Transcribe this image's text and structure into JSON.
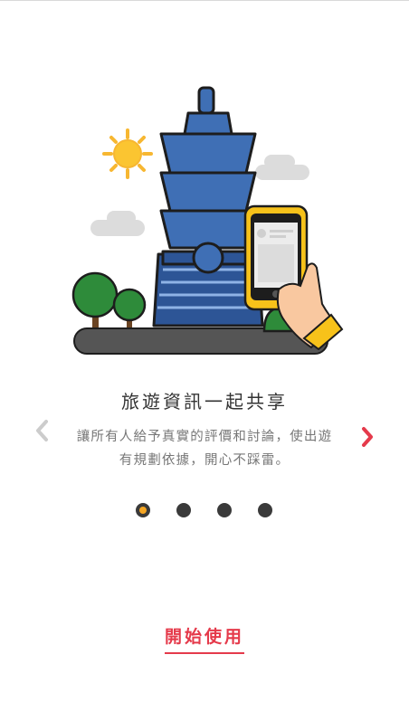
{
  "onboarding": {
    "title": "旅遊資訊一起共享",
    "description": "讓所有人給予真實的評價和討論，使出遊有規劃依據，開心不踩雷。",
    "start_label": "開始使用",
    "page_count": 4,
    "active_page": 1
  },
  "icons": {
    "prev": "chevron-left-icon",
    "next": "chevron-right-icon",
    "illustration": "taipei-101-phone-illustration"
  },
  "colors": {
    "accent": "#e53a4b",
    "dot_active": "#f5a623",
    "dot_inactive": "#3a3a3a",
    "arrow_prev": "#cccccc",
    "arrow_next": "#e53a4b"
  }
}
